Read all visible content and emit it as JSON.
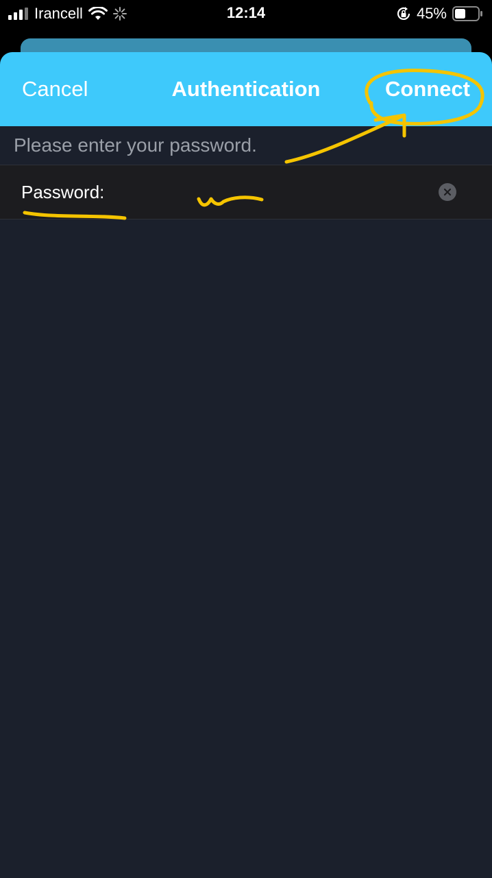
{
  "status_bar": {
    "carrier": "Irancell",
    "time": "12:14",
    "battery_percent": "45%"
  },
  "navbar": {
    "cancel_label": "Cancel",
    "title": "Authentication",
    "connect_label": "Connect"
  },
  "prompt": "Please enter your password.",
  "password_row": {
    "label": "Password:",
    "value": ""
  },
  "colors": {
    "navbar_bg": "#3ec9fb",
    "sheet_bg": "#1b202c",
    "annotation": "#f5c400"
  },
  "icons": [
    "signal-icon",
    "wifi-icon",
    "activity-spinner-icon",
    "rotation-lock-icon",
    "battery-icon",
    "clear-icon"
  ]
}
